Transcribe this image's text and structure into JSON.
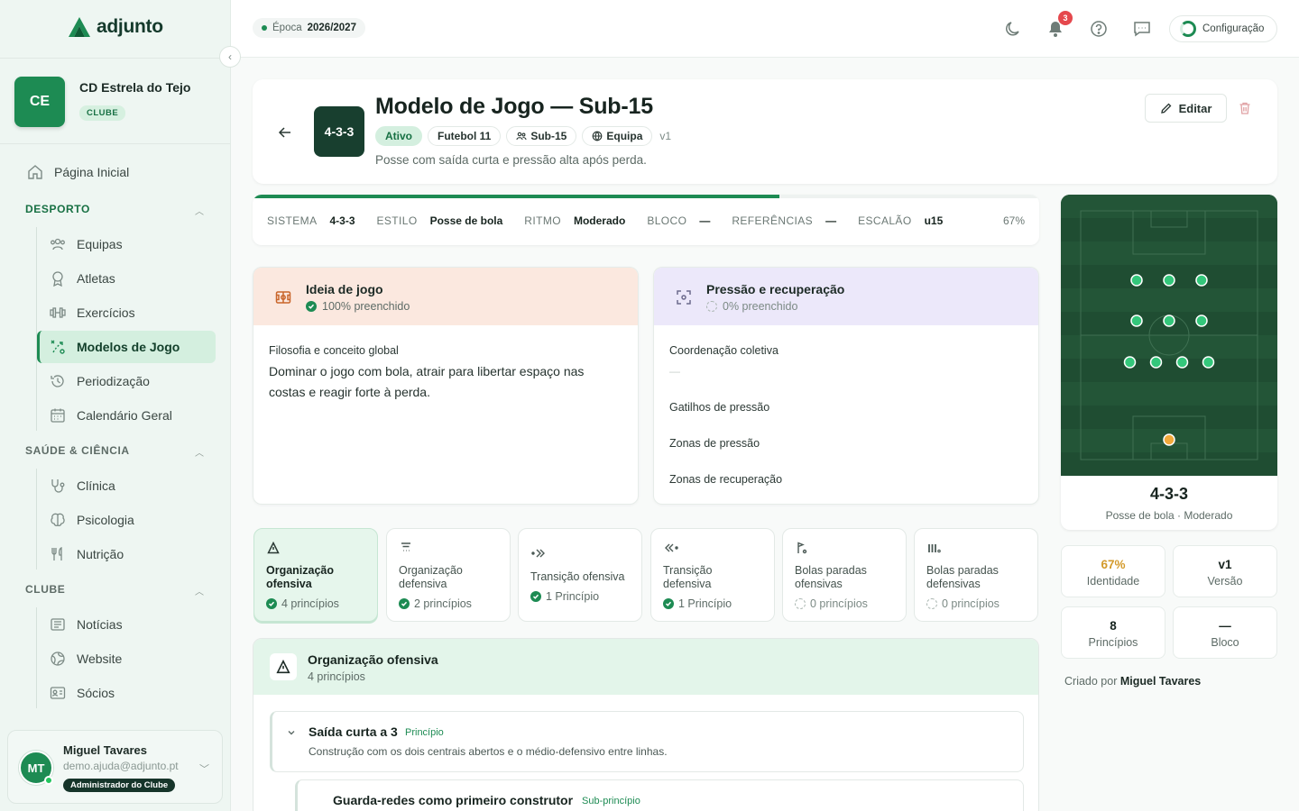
{
  "brand": {
    "name": "adjunto"
  },
  "club": {
    "initials": "CE",
    "name": "CD Estrela do Tejo",
    "tag": "CLUBE"
  },
  "sidebar": {
    "home": "Página Inicial",
    "sections": [
      {
        "title": "DESPORTO",
        "items": [
          "Equipas",
          "Atletas",
          "Exercícios",
          "Modelos de Jogo",
          "Periodização",
          "Calendário Geral"
        ]
      },
      {
        "title": "SAÚDE & CIÊNCIA",
        "items": [
          "Clínica",
          "Psicologia",
          "Nutrição"
        ]
      },
      {
        "title": "CLUBE",
        "items": [
          "Notícias",
          "Website",
          "Sócios"
        ]
      }
    ],
    "active": "Modelos de Jogo"
  },
  "user": {
    "initials": "MT",
    "name": "Miguel Tavares",
    "email": "demo.ajuda@adjunto.pt",
    "role": "Administrador do Clube"
  },
  "topbar": {
    "season_label": "Época",
    "season": "2026/2027",
    "notifications": "3",
    "config": "Configuração"
  },
  "model": {
    "formation": "4-3-3",
    "title": "Modelo de Jogo — Sub-15",
    "status": "Ativo",
    "format": "Futebol 11",
    "age": "Sub-15",
    "scope": "Equipa",
    "version": "v1",
    "description": "Posse com saída curta e pressão alta após perda.",
    "edit": "Editar"
  },
  "summary": {
    "items": [
      {
        "label": "SISTEMA",
        "value": "4-3-3"
      },
      {
        "label": "ESTILO",
        "value": "Posse de bola"
      },
      {
        "label": "RITMO",
        "value": "Moderado"
      },
      {
        "label": "BLOCO",
        "value": "—"
      },
      {
        "label": "REFERÊNCIAS",
        "value": "—"
      },
      {
        "label": "ESCALÃO",
        "value": "u15"
      }
    ],
    "completion": 0.67,
    "completion_text": "67%"
  },
  "idea_card": {
    "title": "Ideia de jogo",
    "status": "100% preenchido",
    "field_label": "Filosofia e conceito global",
    "field_value": "Dominar o jogo com bola, atrair para libertar espaço nas costas e reagir forte à perda."
  },
  "pressure_card": {
    "title": "Pressão e recuperação",
    "status": "0% preenchido",
    "fields": [
      {
        "label": "Coordenação coletiva",
        "value": "—"
      },
      {
        "label": "Gatilhos de pressão",
        "value": ""
      },
      {
        "label": "Zonas de pressão",
        "value": ""
      },
      {
        "label": "Zonas de recuperação",
        "value": ""
      }
    ]
  },
  "phases": [
    {
      "line1": "Organização",
      "line2": "ofensiva",
      "count": "4 princípios",
      "done": true
    },
    {
      "line1": "Organização",
      "line2": "defensiva",
      "count": "2 princípios",
      "done": true
    },
    {
      "line1": "Transição ofensiva",
      "line2": "",
      "count": "1 Princípio",
      "done": true
    },
    {
      "line1": "Transição",
      "line2": "defensiva",
      "count": "1 Princípio",
      "done": true
    },
    {
      "line1": "Bolas paradas",
      "line2": "ofensivas",
      "count": "0 princípios",
      "done": false
    },
    {
      "line1": "Bolas paradas",
      "line2": "defensivas",
      "count": "0 princípios",
      "done": false
    }
  ],
  "principles": {
    "title": "Organização ofensiva",
    "count": "4 princípios",
    "items": [
      {
        "title": "Saída curta a 3",
        "tag": "Princípio",
        "description": "Construção com os dois centrais abertos e o médio-defensivo entre linhas."
      },
      {
        "title": "Guarda-redes como primeiro construtor",
        "tag": "Sub-princípio",
        "description": ""
      }
    ]
  },
  "pitch": {
    "formation": "4-3-3",
    "description": "Posse de bola · Moderado",
    "colors": {
      "grass": "#1f4d32",
      "player": "#34c77b",
      "goalkeeper": "#f2a93b"
    }
  },
  "stats": [
    {
      "value": "67%",
      "label": "Identidade",
      "accent": true
    },
    {
      "value": "v1",
      "label": "Versão",
      "accent": false
    },
    {
      "value": "8",
      "label": "Princípios",
      "accent": false
    },
    {
      "value": "—",
      "label": "Bloco",
      "accent": false
    }
  ],
  "created": {
    "label": "Criado por",
    "name": "Miguel Tavares"
  }
}
